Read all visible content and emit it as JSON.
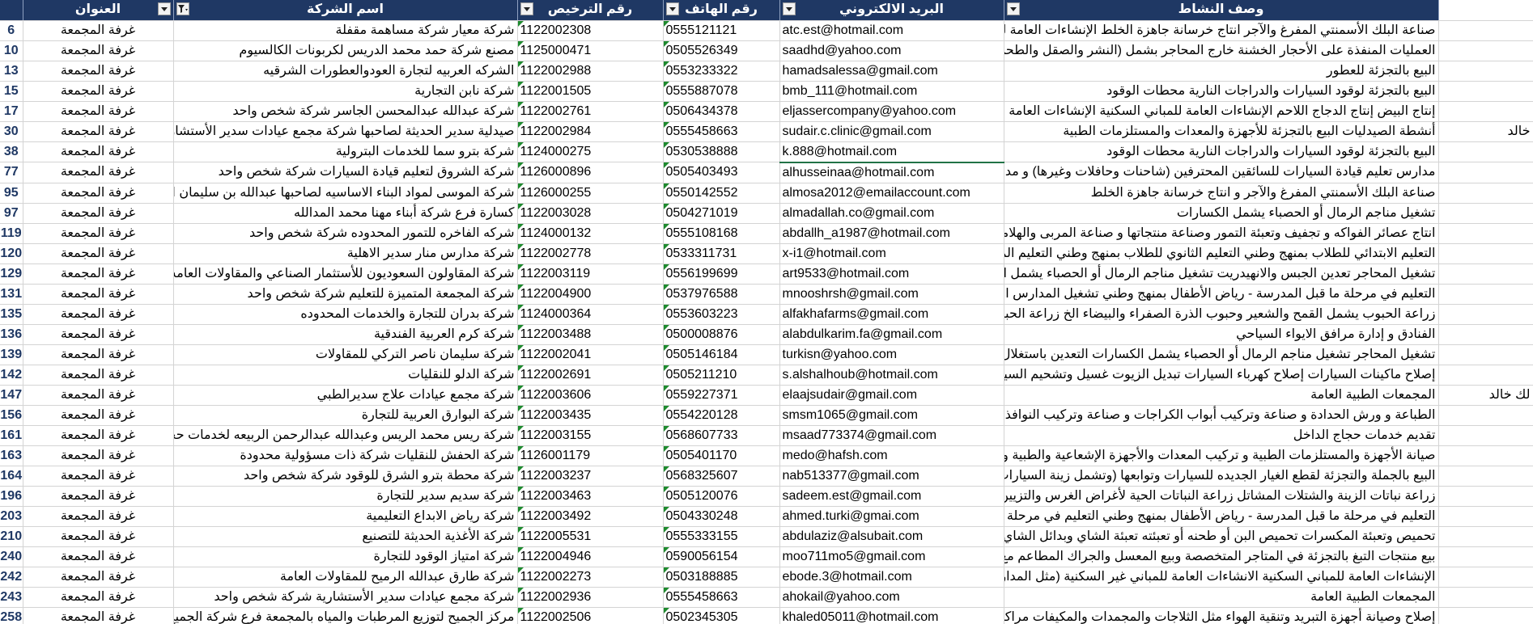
{
  "headers": {
    "address": "العنوان",
    "company_name": "اسم الشركة",
    "license_no": "رقم الترخيص",
    "phone": "رقم الهاتف",
    "email": "البريد الالكتروني",
    "activity": "وصف النشاط"
  },
  "rows": [
    {
      "rn": "6",
      "addr": "غرفة المجمعة",
      "name": "شركة معيار شركة مساهمة مقفلة",
      "lic": "1122002308",
      "ph": "0555121121",
      "em": "atc.est@hotmail.com",
      "act": "صناعة البلك الأسمنتي المفرغ والآجر انتاج خرسانة جاهزة الخلط الإنشاءات العامة للمباني السكنية",
      "ex": ""
    },
    {
      "rn": "10",
      "addr": "غرفة المجمعة",
      "name": "مصنع شركة حمد محمد الدريس لكربونات الكالسيوم",
      "lic": "1125000471",
      "ph": "0505526349",
      "em": "saadhd@yahoo.com",
      "act": "العمليات المنفذة على الأحجار الخشنة خارج المحاجر بشمل (النشر والصقل والطحن .الخ)",
      "ex": ""
    },
    {
      "rn": "13",
      "addr": "غرفة المجمعة",
      "name": "الشركه العربيه لتجارة العودوالعطورات الشرقيه",
      "lic": "1122002988",
      "ph": "0553233322",
      "em": "hamadsalessa@gmail.com",
      "act": "البيع بالتجزئة للعطور",
      "ex": ""
    },
    {
      "rn": "15",
      "addr": "غرفة المجمعة",
      "name": "شركة نابن التجارية",
      "lic": "1122001505",
      "ph": "0555887078",
      "em": "bmb_111@hotmail.com",
      "act": "البيع بالتجزئة لوقود السيارات والدراجات النارية محطات الوقود",
      "ex": ""
    },
    {
      "rn": "17",
      "addr": "غرفة المجمعة",
      "name": "شركة عبدالله عبدالمحسن الجاسر شركة شخص واحد",
      "lic": "1122002761",
      "ph": "0506434378",
      "em": "eljassercompany@yahoo.com",
      "act": "إنتاج البيض إنتاج الدجاج اللاحم الإنشاءات العامة للمباني السكنية الإنشاءات العامة للمباني غير الس",
      "ex": ""
    },
    {
      "rn": "30",
      "addr": "غرفة المجمعة",
      "name": "صيدلية سدير الحديثة لصاحبها شركة مجمع عيادات سدير الأستشارية",
      "lic": "1122002984",
      "ph": "0555458663",
      "em": "sudair.c.clinic@gmail.com",
      "act": "أنشطة الصيدليات البيع بالتجزئة للأجهزة والمعدات والمستلزمات الطبية",
      "ex": "خالد"
    },
    {
      "rn": "38",
      "addr": "غرفة المجمعة",
      "name": "شركة بترو سما للخدمات البترولية",
      "lic": "1124000275",
      "ph": "0530538888",
      "em": "k.888@hotmail.com",
      "act": "البيع بالتجزئة لوقود السيارات والدراجات النارية محطات الوقود",
      "ex": ""
    },
    {
      "rn": "77",
      "addr": "غرفة المجمعة",
      "name": "شركة الشروق لتعليم قيادة السيارات شركة شخص واحد",
      "lic": "1126000896",
      "ph": "0505403493",
      "em": "alhusseinaa@hotmail.com",
      "act": "مدارس تعليم قيادة السيارات للسائقين المحترفين (شاحنات وحافلات وغيرها) و مدارس تعليم قيادة",
      "ex": ""
    },
    {
      "rn": "95",
      "addr": "غرفة المجمعة",
      "name": "شركة الموسى لمواد البناء الاساسيه لصاحبها عبدالله بن سليمان الموسى واولا",
      "lic": "1126000255",
      "ph": "0550142552",
      "em": "almosa2012@emailaccount.com",
      "act": "صناعة البلك الأسمنتي المفرغ والآجر و انتاج خرسانة جاهزة الخلط",
      "ex": ""
    },
    {
      "rn": "97",
      "addr": "غرفة المجمعة",
      "name": "كسارة فرع شركة أبناء مهنا محمد المدالله",
      "lic": "1122003028",
      "ph": "0504271019",
      "em": "almadallah.co@gmail.com",
      "act": "تشغيل مناجم الرمال أو الحصباء  يشمل  الكسارات",
      "ex": ""
    },
    {
      "rn": "119",
      "addr": "غرفة المجمعة",
      "name": "شركه الفاخره للتمور المحدوده شركة شخص واحد",
      "lic": "1124000132",
      "ph": "0555108168",
      "em": "abdallh_a1987@hotmail.com",
      "act": "انتاج عصائر الفواكه و تجفيف وتعبئة التمور وصناعة منتجاتها و صناعة المربى والهلاميات",
      "ex": ""
    },
    {
      "rn": "120",
      "addr": "غرفة المجمعة",
      "name": "شركة مدارس منار سدير الاهلية",
      "lic": "1122002778",
      "ph": "0533311731",
      "em": "x-i1@hotmail.com",
      "act": "التعليم الابتدائي للطلاب بمنهج وطني التعليم الثانوي للطلاب بمنهج وطني التعليم المتوسط للطلا",
      "ex": ""
    },
    {
      "rn": "129",
      "addr": "غرفة المجمعة",
      "name": "شركة المقاولون السعوديون للأستثمار الصناعي والمقاولات العامه",
      "lic": "1122003119",
      "ph": "0556199699",
      "em": "art9533@hotmail.com",
      "act": "تشغيل المحاجر تعدين الجبس والانهيدريت تشغيل مناجم الرمال أو الحصباء  يشمل  الكسارات",
      "ex": ""
    },
    {
      "rn": "131",
      "addr": "غرفة المجمعة",
      "name": "شركة المجمعة المتميزة للتعليم  شركة شخص واحد",
      "lic": "1122004900",
      "ph": "0537976588",
      "em": "mnooshrsh@gmail.com",
      "act": "التعليم في مرحلة ما قبل المدرسة - رياض الأطفال بمنهج وطني تشغيل المدارس المستقلة (تعليم م",
      "ex": ""
    },
    {
      "rn": "135",
      "addr": "غرفة المجمعة",
      "name": "شركة بدران للتجارة والخدمات المحدوده",
      "lic": "1124000364",
      "ph": "0553603223",
      "em": "alfakhafarms@gmail.com",
      "act": "زراعة الحبوب   يشمل   القمح والشعير وحبوب الذرة الصفراء والبيضاء  الخ زراعة الحبوب الحبوبا",
      "ex": ""
    },
    {
      "rn": "136",
      "addr": "غرفة المجمعة",
      "name": "شركة كرم العربية الفندقية",
      "lic": "1122003488",
      "ph": "0500008876",
      "em": "alabdulkarim.fa@gmail.com",
      "act": "الفنادق و إدارة مرافق الايواء السياحي",
      "ex": ""
    },
    {
      "rn": "139",
      "addr": "غرفة المجمعة",
      "name": "شركة سليمان ناصر التركي للمقاولات",
      "lic": "1122002041",
      "ph": "0505146184",
      "em": "turkisn@yahoo.com",
      "act": "تشغيل المحاجر تشغيل مناجم الرمال أو الحصباء  يشمل  الكسارات التعدين باستغلال المحاجر لـ",
      "ex": ""
    },
    {
      "rn": "142",
      "addr": "غرفة المجمعة",
      "name": "شركة الدلو للنقليات",
      "lic": "1122002691",
      "ph": "0505211210",
      "em": "s.alshalhoub@hotmail.com",
      "act": "إصلاح ماكينات السيارات إصلاح كهرباء  السيارات تبديل الزيوت غسيل  وتشحيم السيارات صيانة",
      "ex": ""
    },
    {
      "rn": "147",
      "addr": "غرفة المجمعة",
      "name": "شركة مجمع عيادات علاج سديرالطبي",
      "lic": "1122003606",
      "ph": "0559227371",
      "em": "elaajsudair@gmail.com",
      "act": "المجمعات الطبية العامة",
      "ex": "لك خالد"
    },
    {
      "rn": "156",
      "addr": "غرفة المجمعة",
      "name": "شركة البوارق العربية للتجارة",
      "lic": "1122003435",
      "ph": "0554220128",
      "em": "smsm1065@gmail.com",
      "act": "الطباعة و ورش الحدادة و صناعة وتركيب أبواب الكراجات و صناعة وتركيب النوافذ والأبواب و صنـ",
      "ex": ""
    },
    {
      "rn": "161",
      "addr": "غرفة المجمعة",
      "name": "شركة ريس محمد الريس وعبدالله عبدالرحمن الربيعه لخدمات حجاج الداخل",
      "lic": "1122003155",
      "ph": "0568607733",
      "em": "msaad773374@gmail.com",
      "act": "تقديم خدمات حجاج الداخل",
      "ex": ""
    },
    {
      "rn": "163",
      "addr": "غرفة المجمعة",
      "name": "شركة الحفش للنقليات شركة ذات مسؤولية محدودة",
      "lic": "1126001179",
      "ph": "0505401170",
      "em": "medo@hafsh.com",
      "act": "صيانة الأجهزة والمستلزمات الطبية و تركيب المعدات والأجهزة الإشعاعية والطبية و البيع بالجملة",
      "ex": ""
    },
    {
      "rn": "164",
      "addr": "غرفة المجمعة",
      "name": "شركة محطة بترو الشرق للوقود شركة شخص واحد",
      "lic": "1122003237",
      "ph": "0568325607",
      "em": "nab513377@gmail.com",
      "act": "البيع بالجملة والتجزئة لقطع الغيار الجديده للسيارات وتوابعها (وتشمل زينة السيارات) البيع بالجم",
      "ex": ""
    },
    {
      "rn": "196",
      "addr": "غرفة المجمعة",
      "name": "شركة سديم سدير للتجارة",
      "lic": "1122003463",
      "ph": "0505120076",
      "em": "sadeem.est@gmail.com",
      "act": "زراعة نباتات الزينة والشتلات المشاتل زراعة النباتات الحية لأغراض الغرس والتزيين  نباتات الزينة",
      "ex": ""
    },
    {
      "rn": "203",
      "addr": "غرفة المجمعة",
      "name": "شركة رياض الابداع التعليمية",
      "lic": "1122003492",
      "ph": "0504330248",
      "em": "ahmed.turki@gmai.com",
      "act": "التعليم في مرحلة ما قبل المدرسة - رياض الأطفال بمنهج وطني التعليم في مرحلة ما قبل المدرسة -",
      "ex": ""
    },
    {
      "rn": "210",
      "addr": "غرفة المجمعة",
      "name": "شركة الأغذية الحديثة للتصنيع",
      "lic": "1122005531",
      "ph": "0555333155",
      "em": "abdulaziz@alsubait.com",
      "act": "تحميص وتعبئة المكسرات تحميص البن أو طحنه أو تعبئته تعبئة الشاي وبدائل الشاي  يشمل  النعـ",
      "ex": ""
    },
    {
      "rn": "240",
      "addr": "غرفة المجمعة",
      "name": "شركة امتياز الوقود للتجارة",
      "lic": "1122004946",
      "ph": "0590056154",
      "em": "moo711mo5@gmail.com",
      "act": "بيع منتجات التبغ  بالتجزئة في المتاجر المتخصصة وبيع المعسل والجراك المطاعم مع الخدمة الم",
      "ex": ""
    },
    {
      "rn": "242",
      "addr": "غرفة المجمعة",
      "name": "شركة طارق عبدالله الرميح للمقاولات العامة",
      "lic": "1122002273",
      "ph": "0503188885",
      "em": "ebode.3@hotmail.com",
      "act": "الإنشاءات العامة للمباني السكنية الانشاءات العامة للمباني غير السكنية (مثل المدارس والمستشفيا",
      "ex": ""
    },
    {
      "rn": "243",
      "addr": "غرفة المجمعة",
      "name": "شركة مجمع عيادات سدير الأستشارية شركة شخص واحد",
      "lic": "1122002936",
      "ph": "0555458663",
      "em": "ahokail@yahoo.com",
      "act": "المجمعات الطبية العامة",
      "ex": ""
    },
    {
      "rn": "258",
      "addr": "غرفة المجمعة",
      "name": "مركز الجميح لتوزيع المرطبات والمياه بالمجمعة فرع شركة الجميح القابضة",
      "lic": "1122002506",
      "ph": "0502345305",
      "em": "khaled05011@hotmail.com",
      "act": "إصلاح وصيانة أجهزة التبريد وتنقية الهواء مثل الثلاجات والمجمدات والمكيفات مراكز التوزيـع لأ",
      "ex": ""
    }
  ]
}
